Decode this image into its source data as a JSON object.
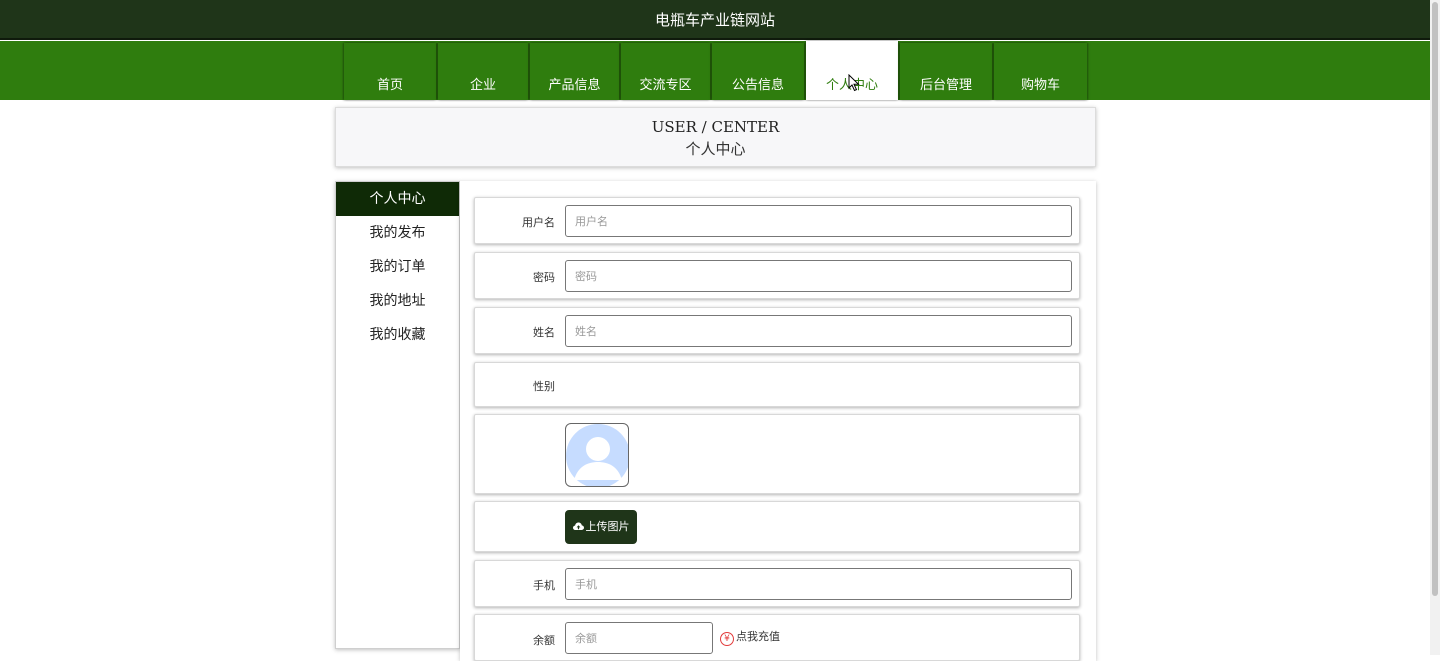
{
  "site": {
    "title": "电瓶车产业链网站"
  },
  "nav": {
    "items": [
      {
        "label": "首页"
      },
      {
        "label": "企业"
      },
      {
        "label": "产品信息"
      },
      {
        "label": "交流专区"
      },
      {
        "label": "公告信息"
      },
      {
        "label": "个人中心"
      },
      {
        "label": "后台管理"
      },
      {
        "label": "购物车"
      }
    ],
    "active": "个人中心"
  },
  "header": {
    "title_en": "USER / CENTER",
    "title_zh": "个人中心"
  },
  "sidebar": {
    "items": [
      {
        "label": "个人中心"
      },
      {
        "label": "我的发布"
      },
      {
        "label": "我的订单"
      },
      {
        "label": "我的地址"
      },
      {
        "label": "我的收藏"
      }
    ]
  },
  "form": {
    "username": {
      "label": "用户名",
      "placeholder": "用户名",
      "value": ""
    },
    "password": {
      "label": "密码",
      "placeholder": "密码",
      "value": ""
    },
    "name": {
      "label": "姓名",
      "placeholder": "姓名",
      "value": ""
    },
    "gender": {
      "label": "性别"
    },
    "avatar": {
      "icon": "user-avatar-placeholder"
    },
    "upload": {
      "label": "上传图片",
      "icon": "cloud-upload-icon"
    },
    "phone": {
      "label": "手机",
      "placeholder": "手机",
      "value": ""
    },
    "balance": {
      "label": "余额",
      "placeholder": "余额",
      "value": "",
      "recharge_label": "点我充值",
      "recharge_icon": "yen-icon"
    }
  },
  "colors": {
    "topbar": "#1f3519",
    "nav": "#2f7d0e",
    "sidebar_active": "#0f2a06",
    "avatar": "#c6dcff"
  }
}
